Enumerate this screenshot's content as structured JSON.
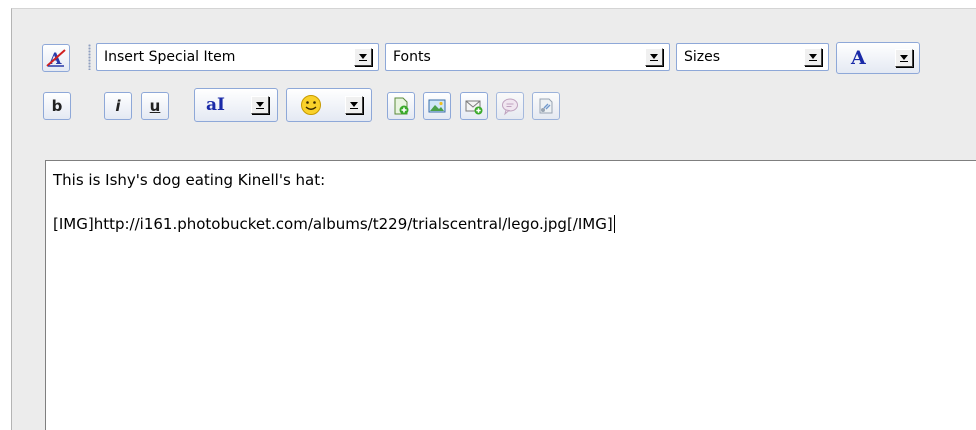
{
  "toolbar": {
    "special_item_select": {
      "value": "Insert Special Item"
    },
    "fonts_select": {
      "value": "Fonts"
    },
    "sizes_select": {
      "value": "Sizes"
    },
    "font_color_label": "A",
    "bold_label": "b",
    "italic_label": "i",
    "underline_label": "u",
    "text_style_label": "aI",
    "icons": {
      "remove_format": "remove-format-icon",
      "smiley": "smiley-icon",
      "insert_link": "insert-link-icon",
      "insert_image": "insert-image-icon",
      "insert_email": "insert-email-icon",
      "insert_quote": "quote-bubble-icon",
      "insert_code": "code-icon"
    }
  },
  "editor": {
    "lines": [
      "This is Ishy's dog eating Kinell's hat:",
      "[IMG]http://i161.photobucket.com/albums/t229/trialscentral/lego.jpg[/IMG]"
    ]
  },
  "colors": {
    "toolbar_background": "#ececec",
    "button_border": "#8ea8d8",
    "font_color_accent": "#1a2aa8"
  }
}
